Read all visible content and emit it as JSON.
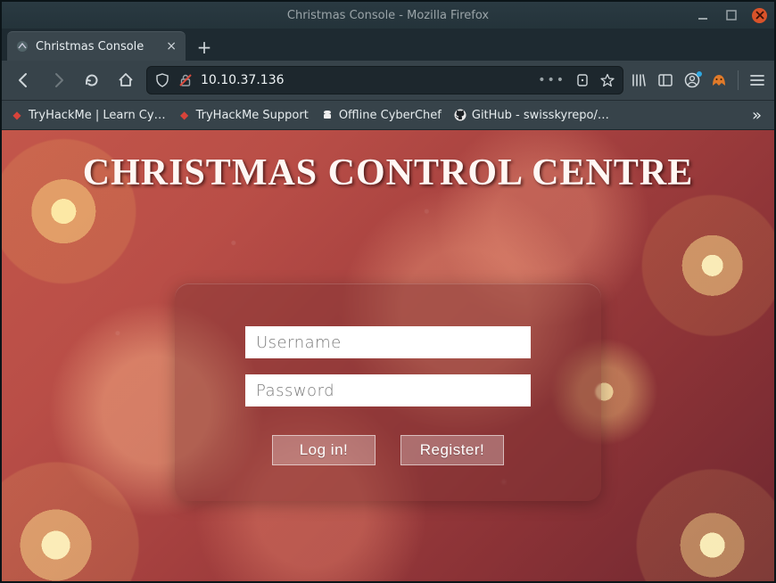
{
  "window": {
    "title": "Christmas Console - Mozilla Firefox"
  },
  "tab": {
    "label": "Christmas Console"
  },
  "urlbar": {
    "url": "10.10.37.136"
  },
  "bookmarks": [
    {
      "label": "TryHackMe | Learn Cy…"
    },
    {
      "label": "TryHackMe Support"
    },
    {
      "label": "Offline CyberChef"
    },
    {
      "label": "GitHub - swisskyrepo/…"
    }
  ],
  "page": {
    "heading": "CHRISTMAS CONTROL CENTRE",
    "username_placeholder": "Username",
    "password_placeholder": "Password",
    "login_label": "Log in!",
    "register_label": "Register!"
  }
}
